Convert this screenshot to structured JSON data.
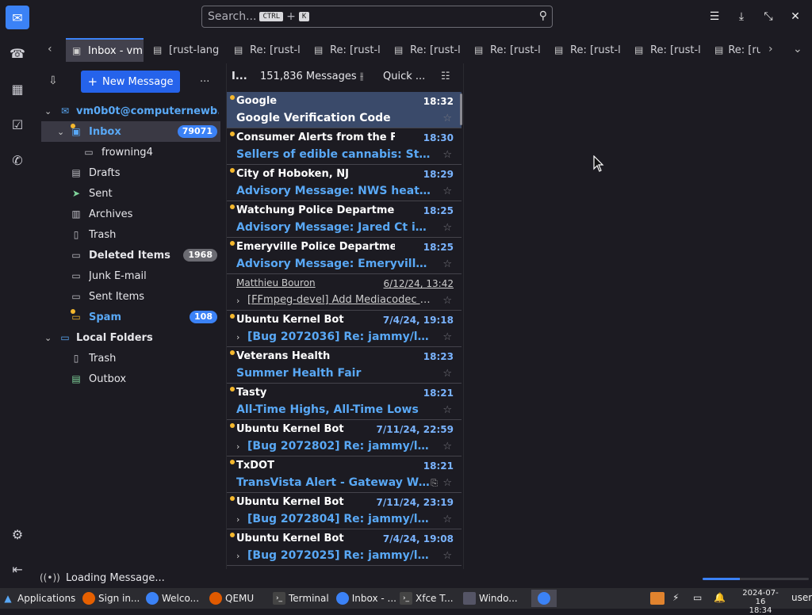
{
  "search": {
    "placeholder": "Search...",
    "shortcut_mod": "CTRL",
    "shortcut_plus": "+",
    "shortcut_key": "K"
  },
  "tabs": [
    {
      "label": "Inbox - vm"
    },
    {
      "label": "[rust-lang"
    },
    {
      "label": "Re: [rust-l"
    },
    {
      "label": "Re: [rust-l"
    },
    {
      "label": "Re: [rust-l"
    },
    {
      "label": "Re: [rust-l"
    },
    {
      "label": "Re: [rust-l"
    },
    {
      "label": "Re: [rust-l"
    },
    {
      "label": "Re: [ru"
    }
  ],
  "folders": {
    "new_message_label": "New Message",
    "more_label": "...",
    "account": "vm0b0t@computernewb....",
    "items": [
      {
        "label": "Inbox",
        "badge": "79071"
      },
      {
        "label": "frowning4"
      },
      {
        "label": "Drafts"
      },
      {
        "label": "Sent"
      },
      {
        "label": "Archives"
      },
      {
        "label": "Trash"
      },
      {
        "label": "Deleted Items",
        "badge": "1968"
      },
      {
        "label": "Junk E-mail"
      },
      {
        "label": "Sent Items"
      },
      {
        "label": "Spam",
        "badge": "108"
      }
    ],
    "local_folders": "Local Folders",
    "local_items": [
      {
        "label": "Trash"
      },
      {
        "label": "Outbox"
      }
    ]
  },
  "list": {
    "header_short": "I...",
    "count": "151,836 Messages",
    "quick_filter": "Quick ...",
    "messages": [
      {
        "sender": "Google",
        "time": "18:32",
        "subject": "Google Verification Code"
      },
      {
        "sender": "Consumer Alerts from the FTC",
        "time": "18:30",
        "subject": "Sellers of edible cannabis: Stop u..."
      },
      {
        "sender": "City of Hoboken, NJ",
        "time": "18:29",
        "subject": "Advisory Message: NWS heat advi..."
      },
      {
        "sender": "Watchung Police Department",
        "time": "18:25",
        "subject": "Advisory Message: Jared Ct is no..."
      },
      {
        "sender": "Emeryville Police Department",
        "time": "18:25",
        "subject": "Advisory Message: Emeryville PD ..."
      },
      {
        "sender": "Matthieu Bouron",
        "time": "6/12/24, 13:42",
        "subject": "[FFmpeg-devel] Add Mediacodec a..."
      },
      {
        "sender": "Ubuntu Kernel Bot",
        "time": "7/4/24, 19:18",
        "subject": "[Bug 2072036] Re: jammy/linux-..."
      },
      {
        "sender": "Veterans Health",
        "time": "18:23",
        "subject": "Summer Health Fair"
      },
      {
        "sender": "Tasty",
        "time": "18:21",
        "subject": "All-Time Highs, All-Time Lows"
      },
      {
        "sender": "Ubuntu Kernel Bot",
        "time": "7/11/24, 22:59",
        "subject": "[Bug 2072802] Re: jammy/linux-..."
      },
      {
        "sender": "TxDOT",
        "time": "18:21",
        "subject": "TransVista Alert - Gateway Wes..."
      },
      {
        "sender": "Ubuntu Kernel Bot",
        "time": "7/11/24, 23:19",
        "subject": "[Bug 2072804] Re: jammy/linux-..."
      },
      {
        "sender": "Ubuntu Kernel Bot",
        "time": "7/4/24, 19:08",
        "subject": "[Bug 2072025] Re: jammy/linux-..."
      }
    ]
  },
  "status": {
    "text": "Loading Message...",
    "progress": 0.35
  },
  "taskbar": {
    "items": [
      {
        "label": "Applications"
      },
      {
        "label": "Sign in..."
      },
      {
        "label": "Welco..."
      },
      {
        "label": "QEMU"
      },
      {
        "label": "Terminal"
      },
      {
        "label": "Inbox - ..."
      },
      {
        "label": "Xfce T..."
      },
      {
        "label": "Windo..."
      }
    ],
    "date": "2024-07-16",
    "time": "18:34",
    "user": "user"
  },
  "colors": {
    "accent": "#3b82f6",
    "unread_dot": "#f5b82e",
    "subject_blue": "#59a8f5"
  }
}
